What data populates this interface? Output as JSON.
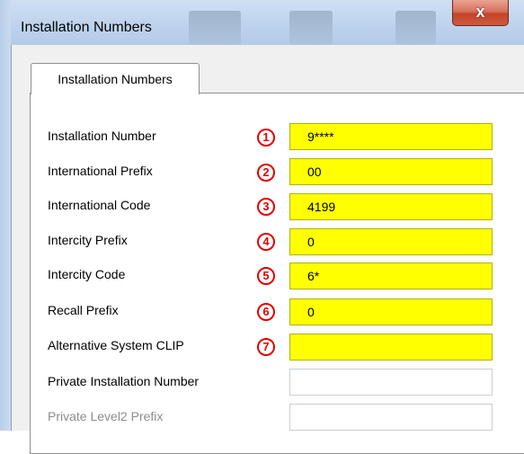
{
  "window": {
    "title": "Installation Numbers",
    "close_label": "x"
  },
  "tab": {
    "label": "Installation Numbers"
  },
  "rows": [
    {
      "label": "Installation Number",
      "marker": "1",
      "value": "9****",
      "highlighted": true
    },
    {
      "label": "International Prefix",
      "marker": "2",
      "value": "00",
      "highlighted": true
    },
    {
      "label": "International Code",
      "marker": "3",
      "value": "4199",
      "highlighted": true
    },
    {
      "label": "Intercity Prefix",
      "marker": "4",
      "value": "0",
      "highlighted": true
    },
    {
      "label": "Intercity Code",
      "marker": "5",
      "value": "6*",
      "highlighted": true
    },
    {
      "label": "Recall Prefix",
      "marker": "6",
      "value": "0",
      "highlighted": true
    },
    {
      "label": "Alternative System CLIP",
      "marker": "7",
      "value": "",
      "highlighted": true
    },
    {
      "label": "Private Installation Number",
      "value": ""
    },
    {
      "label": "Private Level2 Prefix",
      "value": "",
      "disabled": true
    }
  ],
  "colors": {
    "highlight": "#ffff00",
    "marker": "#e30000",
    "close_button": "#c4432a"
  }
}
